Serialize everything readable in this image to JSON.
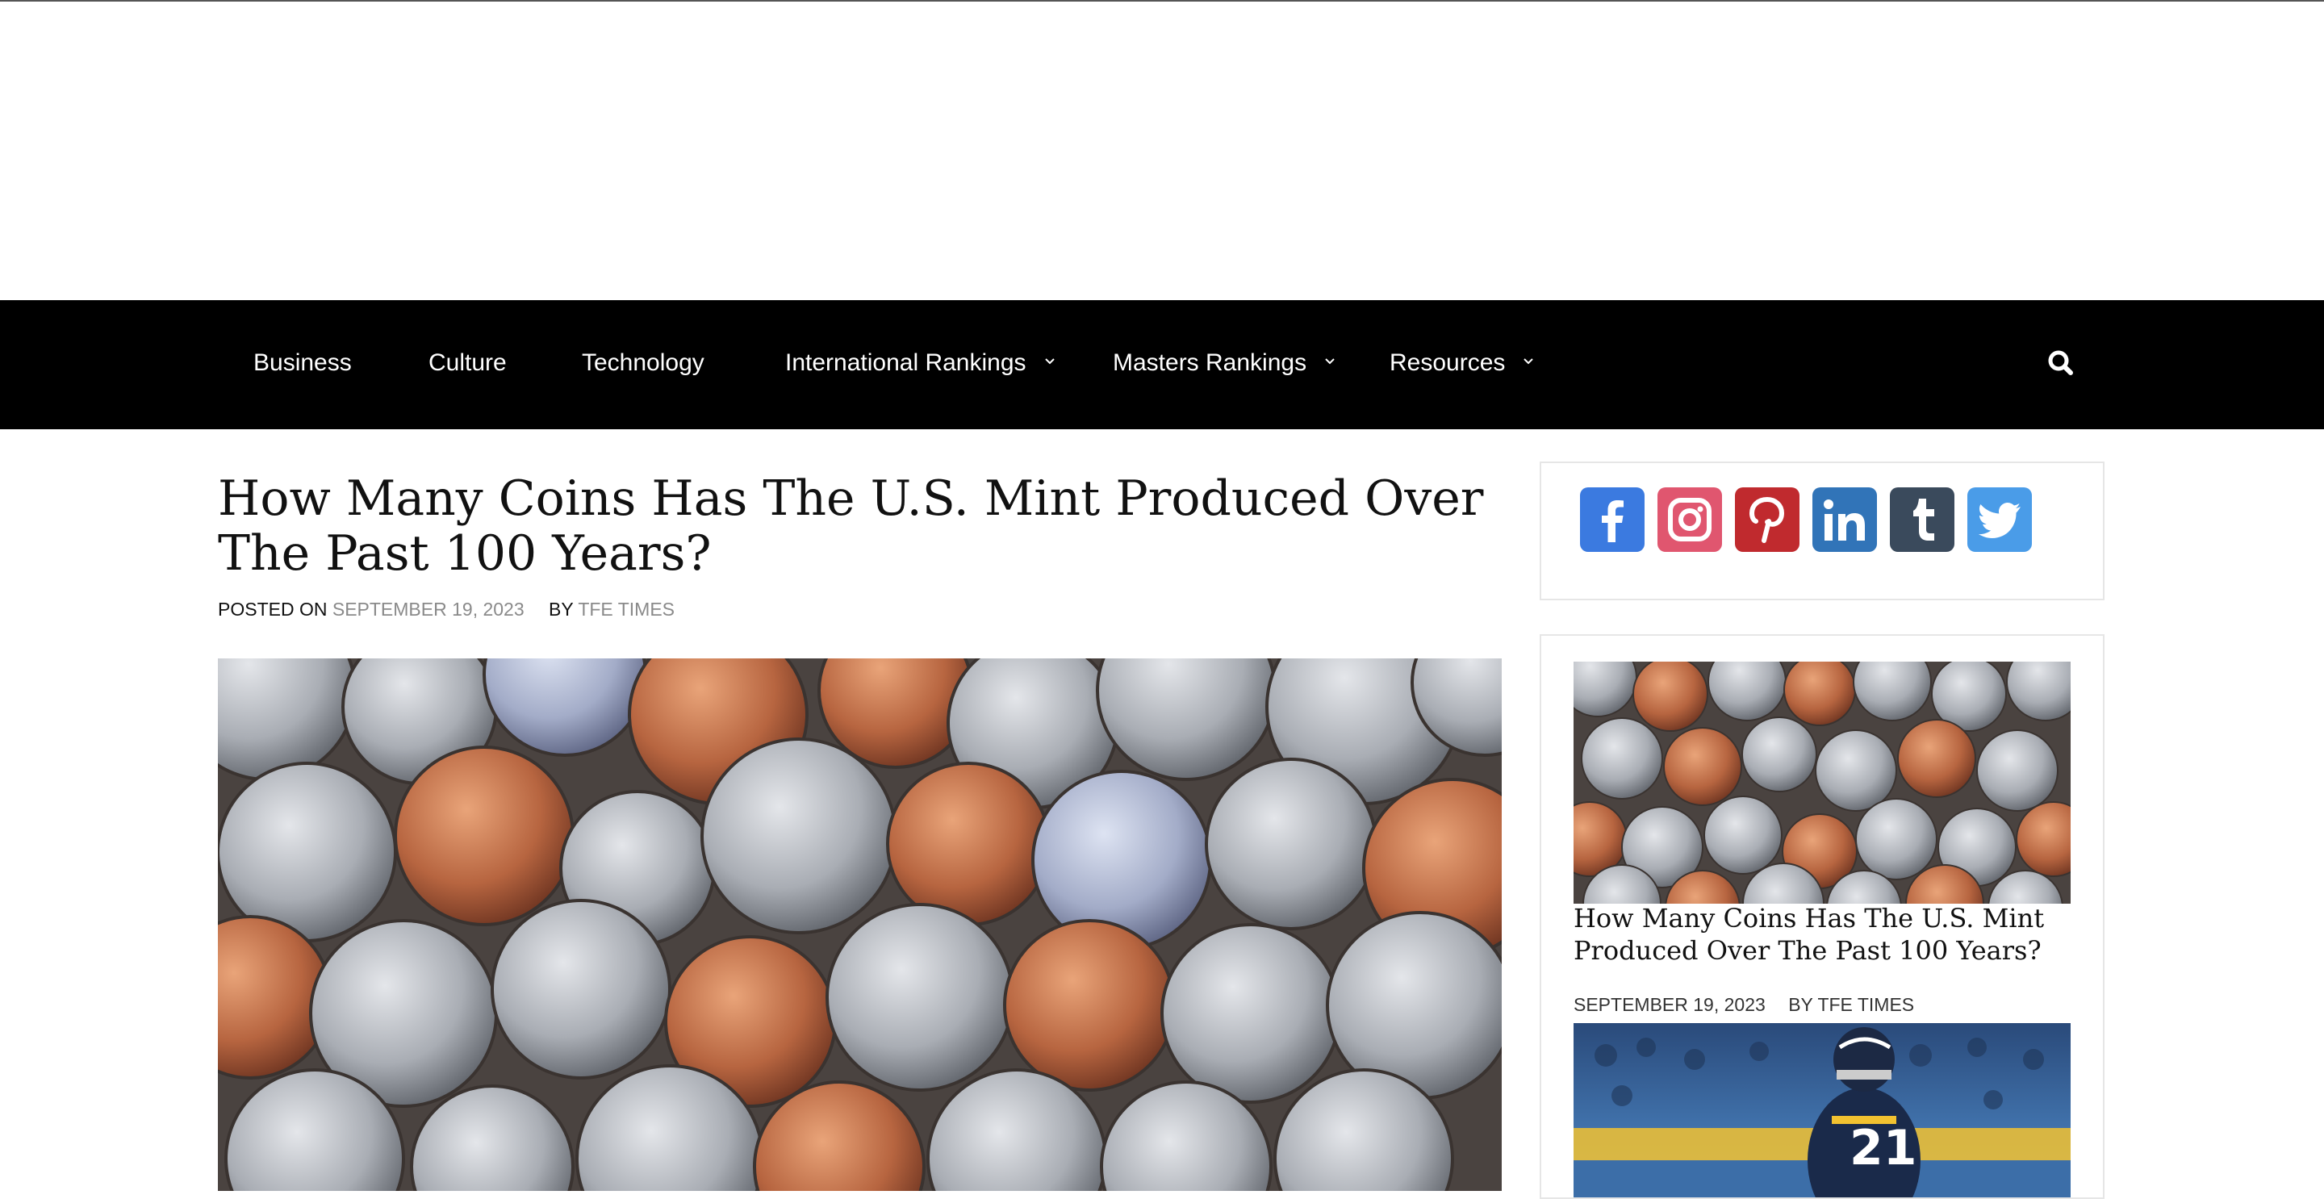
{
  "nav": {
    "items": [
      {
        "label": "Business",
        "dropdown": false
      },
      {
        "label": "Culture",
        "dropdown": false
      },
      {
        "label": "Technology",
        "dropdown": false
      },
      {
        "label": "International Rankings",
        "dropdown": true
      },
      {
        "label": "Masters Rankings",
        "dropdown": true
      },
      {
        "label": "Resources",
        "dropdown": true
      }
    ],
    "search_icon": "search-icon"
  },
  "article": {
    "title": "How Many Coins Has The U.S. Mint Produced Over The Past 100 Years?",
    "posted_on_label": "POSTED ON",
    "date": "SEPTEMBER 19, 2023",
    "by_label": "BY",
    "author": "TFE TIMES",
    "image": "coins-photo"
  },
  "sidebar": {
    "social": [
      {
        "name": "facebook",
        "color": "#3b7ae0"
      },
      {
        "name": "instagram",
        "color": "#e0566f"
      },
      {
        "name": "pinterest",
        "color": "#c02a2e"
      },
      {
        "name": "linkedin",
        "color": "#3174b8"
      },
      {
        "name": "tumblr",
        "color": "#3a4a5c"
      },
      {
        "name": "twitter",
        "color": "#4a9ce8"
      }
    ],
    "post": {
      "title": "How Many Coins Has The U.S. Mint Produced Over The Past 100 Years?",
      "date": "SEPTEMBER 19, 2023",
      "by_label": "BY",
      "author": "TFE TIMES"
    },
    "next_post_image": "football-player-photo"
  }
}
